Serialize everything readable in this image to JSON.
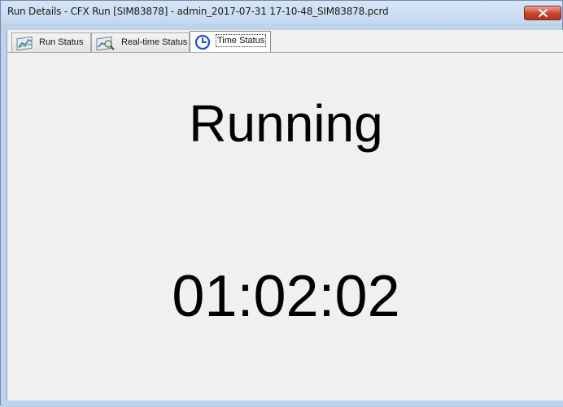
{
  "window": {
    "title": "Run Details - CFX Run [SIM83878] - admin_2017-07-31 17-10-48_SIM83878.pcrd",
    "close_icon": "close-icon"
  },
  "tabs": [
    {
      "label": "Run Status",
      "icon": "chart-icon",
      "active": false
    },
    {
      "label": "Real-time Status",
      "icon": "chart-search-icon",
      "active": false
    },
    {
      "label": "Time Status",
      "icon": "clock-icon",
      "active": true
    }
  ],
  "panel": {
    "status": "Running",
    "elapsed_time": "01:02:02"
  },
  "colors": {
    "close_button": "#c8432c",
    "clock_accent": "#1e4fd1",
    "panel_background": "#f0f0f0",
    "title_bar": "#c9dcf0"
  }
}
